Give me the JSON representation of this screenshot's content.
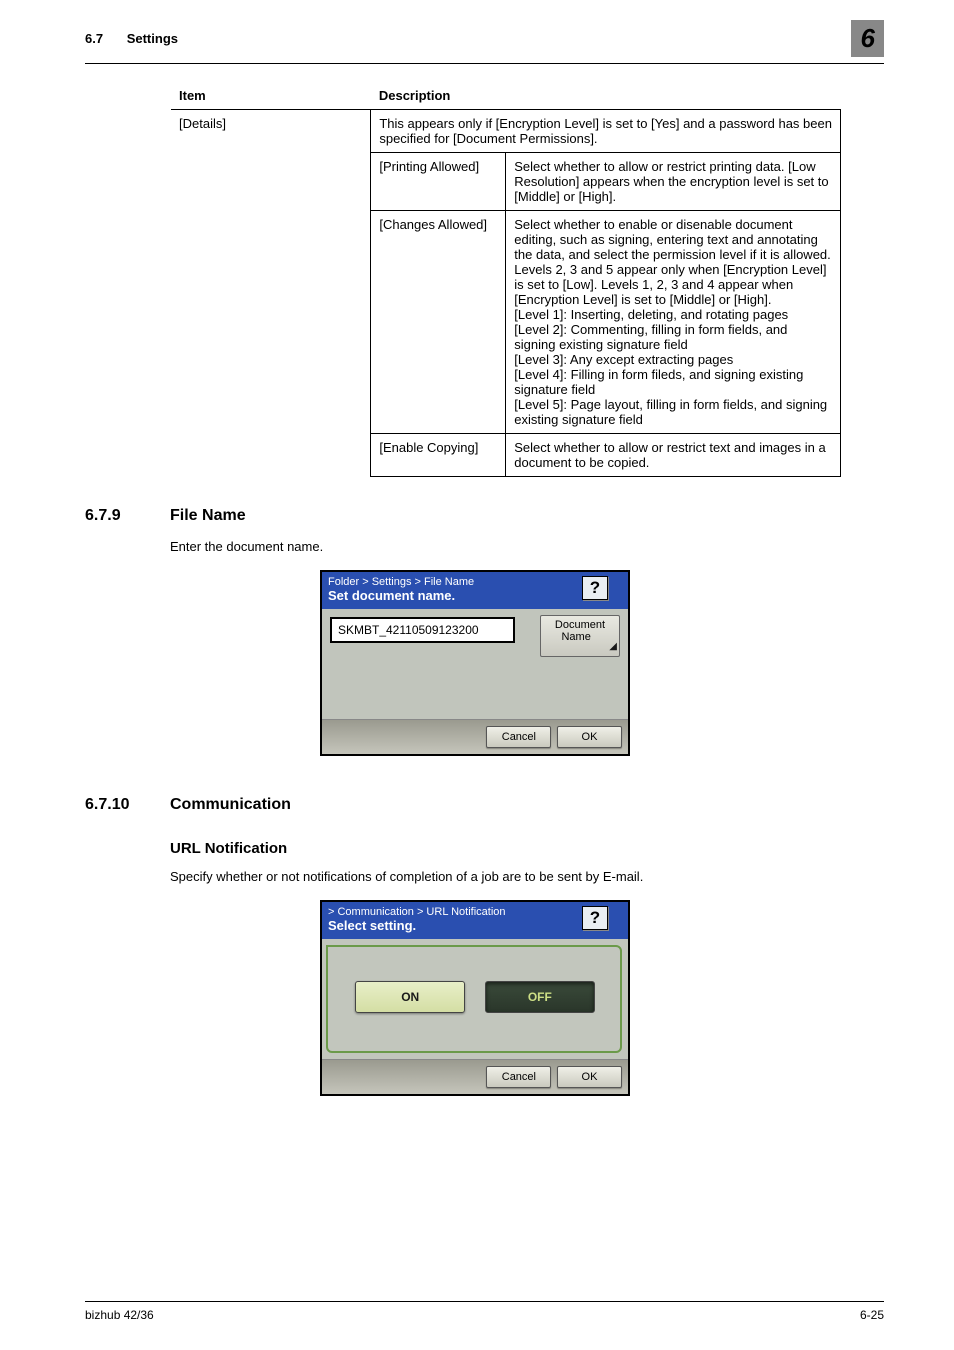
{
  "header": {
    "section_number": "6.7",
    "section_name": "Settings",
    "chapter_number": "6"
  },
  "table": {
    "head_item": "Item",
    "head_desc": "Description",
    "details_label": "[Details]",
    "details_desc": "This appears only if [Encryption Level] is set to [Yes] and a password has been specified for [Document Permissions].",
    "printing_allowed_label": "[Printing Allowed]",
    "printing_allowed_desc": "Select whether to allow or restrict printing data. [Low Resolution] appears when the encryption level is set to [Middle] or [High].",
    "changes_allowed_label": "[Changes Allowed]",
    "changes_allowed_desc": "Select whether to enable or disenable document editing, such as signing, entering text and annotating the data, and select the permission level if it is allowed.\nLevels 2, 3 and 5 appear only when [Encryption Level] is set to [Low]. Levels 1, 2, 3 and 4 appear when [Encryption Level] is set to [Middle] or [High].\n[Level 1]: Inserting, deleting, and rotating pages\n[Level 2]: Commenting, filling in form fields, and signing existing signature field\n[Level 3]: Any except extracting pages\n[Level 4]: Filling in form fileds, and signing existing signature field\n[Level 5]: Page layout, filling in form fields, and signing existing signature field",
    "enable_copying_label": "[Enable Copying]",
    "enable_copying_desc": "Select whether to allow or restrict text and images in a document to be copied."
  },
  "sec679": {
    "num": "6.7.9",
    "title": "File Name",
    "body": "Enter the document name.",
    "panel": {
      "breadcrumb": "Folder > Settings > File Name",
      "title": "Set document name.",
      "help": "?",
      "filename_value": "SKMBT_42110509123200",
      "doc_name_btn": "Document Name",
      "cancel": "Cancel",
      "ok": "OK"
    }
  },
  "sec6710": {
    "num": "6.7.10",
    "title": "Communication",
    "sub_title": "URL Notification",
    "body": "Specify whether or not notifications of completion of a job are to be sent by E-mail.",
    "panel": {
      "breadcrumb": "> Communication > URL Notification",
      "title": "Select setting.",
      "help": "?",
      "on": "ON",
      "off": "OFF",
      "cancel": "Cancel",
      "ok": "OK"
    }
  },
  "footer": {
    "left": "bizhub 42/36",
    "right": "6-25"
  }
}
